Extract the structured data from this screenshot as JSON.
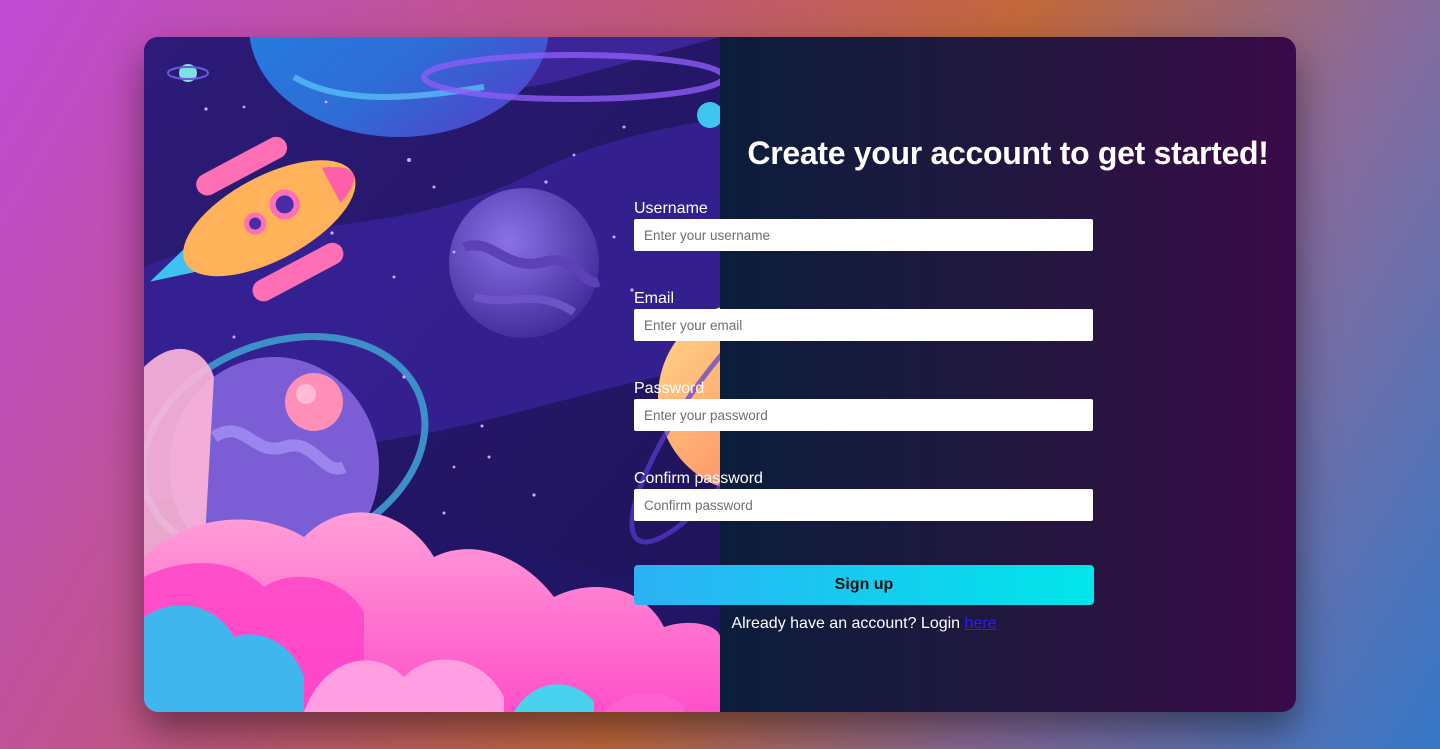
{
  "form": {
    "title": "Create your account to get started!",
    "fields": [
      {
        "label": "Username",
        "placeholder": "Enter your username"
      },
      {
        "label": "Email",
        "placeholder": "Enter your email"
      },
      {
        "label": "Password",
        "placeholder": "Enter your password"
      },
      {
        "label": "Confirm password",
        "placeholder": "Confirm password"
      }
    ],
    "submit_label": "Sign up",
    "login_prompt": "Already have an account? Login ",
    "login_link": "here"
  },
  "illustration": {
    "subject": "space-scene",
    "icons": [
      "rocket-icon",
      "planet-icon",
      "cloud-icon",
      "star-icon"
    ]
  },
  "colors": {
    "panel_start": "#0c1d3c",
    "panel_end": "#3a0a48",
    "button_start": "#2cb1f5",
    "button_end": "#00e6ea",
    "link": "#2b1bff"
  }
}
